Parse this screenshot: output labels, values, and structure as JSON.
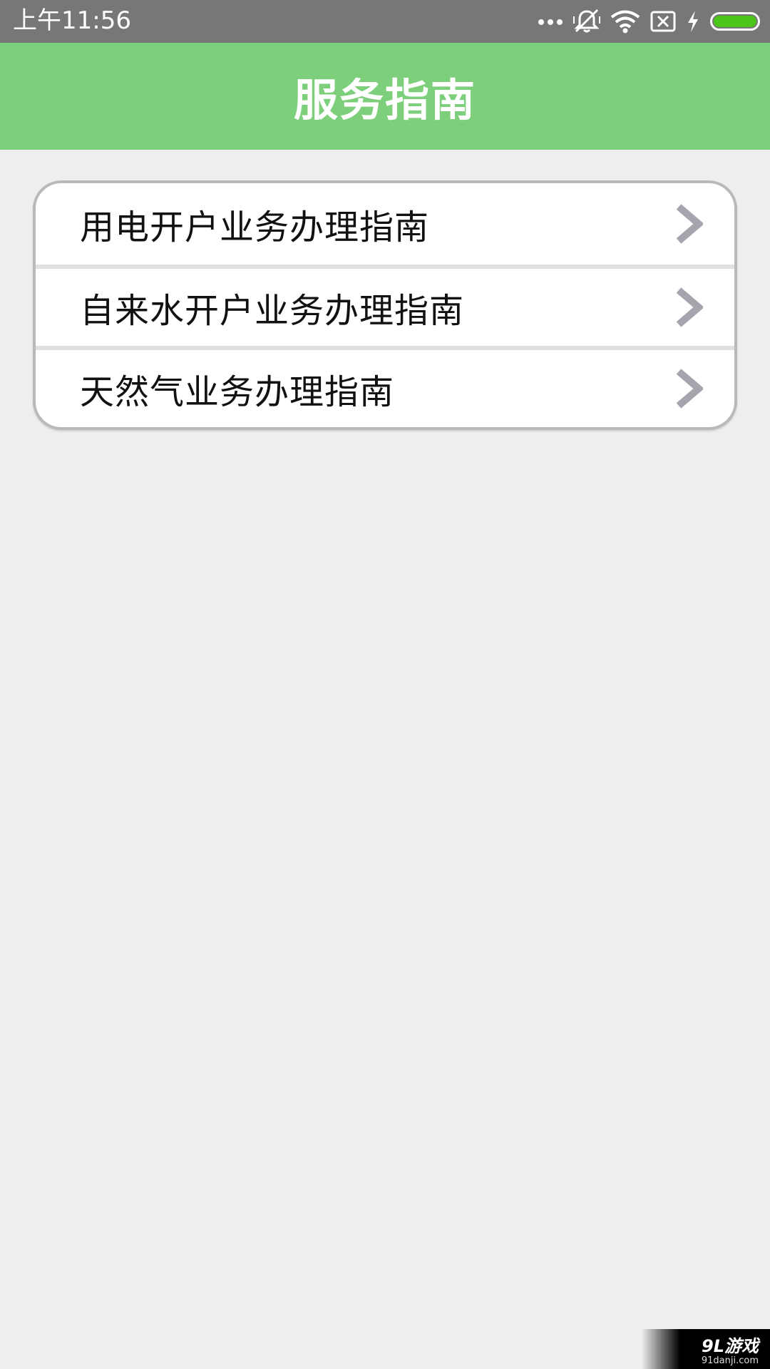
{
  "status_bar": {
    "time": "上午11:56",
    "icons": [
      "more-dots-icon",
      "mute-icon",
      "wifi-icon",
      "no-sim-icon",
      "charging-icon",
      "battery-icon"
    ],
    "battery_level": 1.0,
    "battery_color": "#4cc51a"
  },
  "header": {
    "title": "服务指南",
    "background": "#7dcf7c"
  },
  "guide_list": {
    "items": [
      {
        "label": "用电开户业务办理指南",
        "icon": "chevron-right-icon"
      },
      {
        "label": "自来水开户业务办理指南",
        "icon": "chevron-right-icon"
      },
      {
        "label": "天然气业务办理指南",
        "icon": "chevron-right-icon"
      }
    ]
  },
  "watermark": {
    "logo": "9L游戏",
    "url": "91danji.com"
  }
}
